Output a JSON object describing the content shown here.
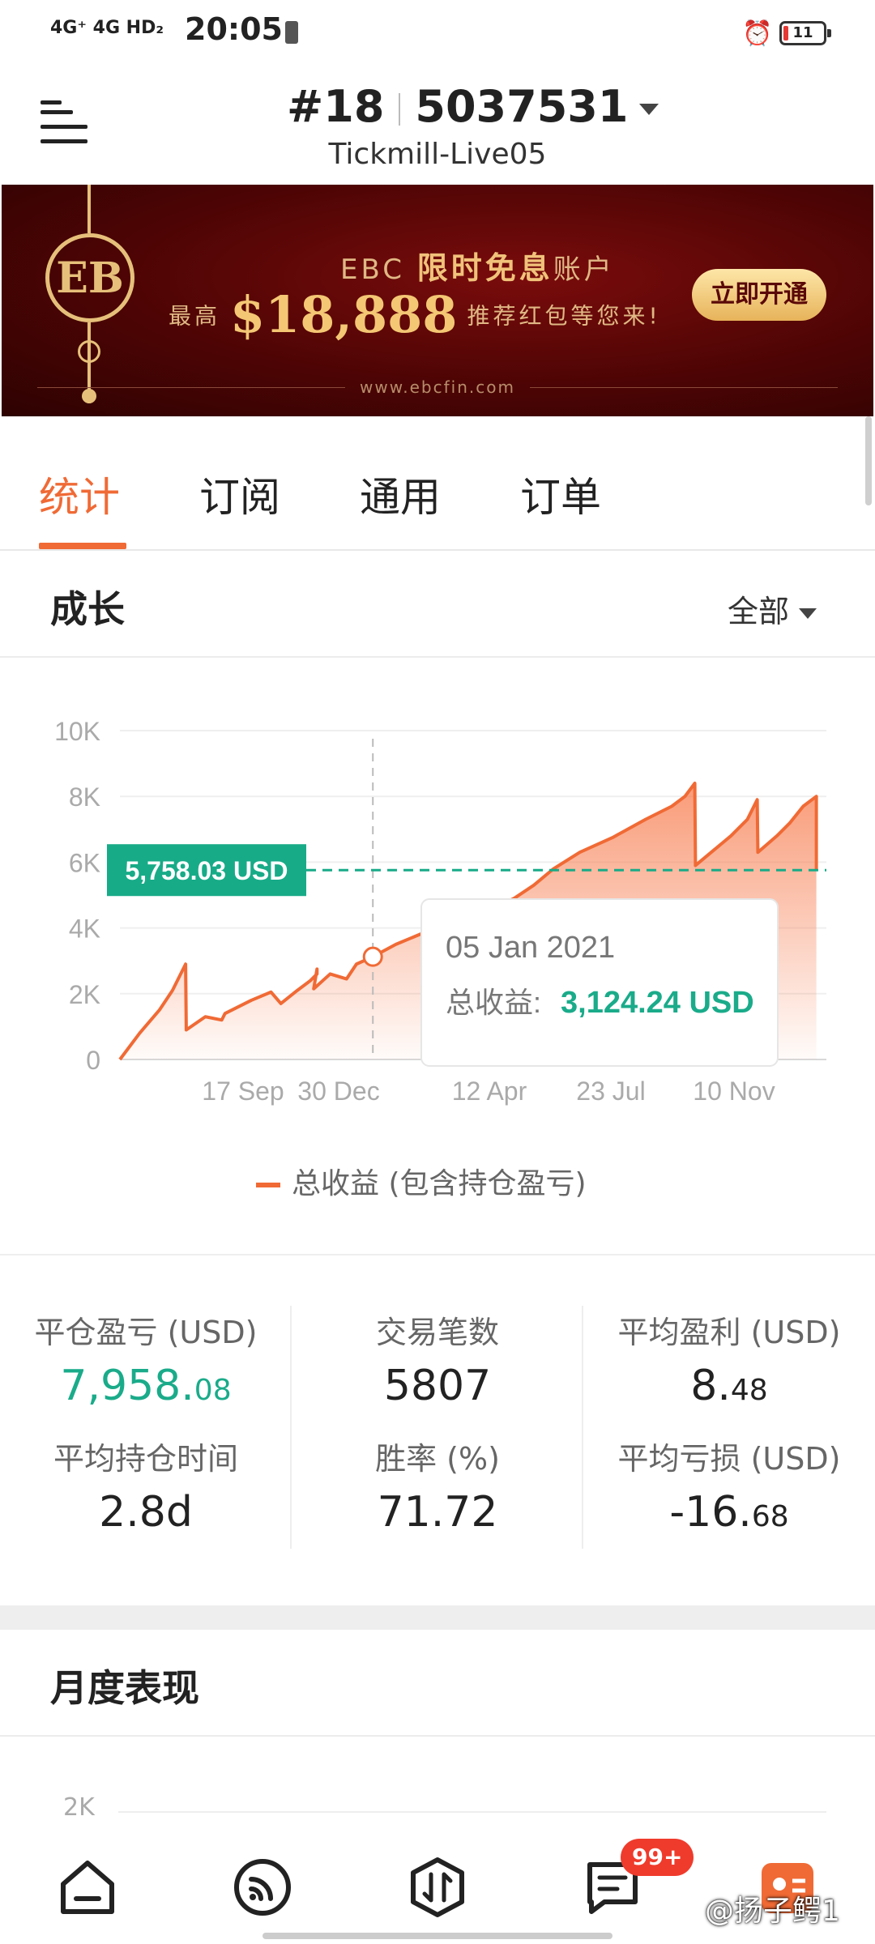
{
  "status_bar": {
    "network": "4G⁺ 4G HD₂",
    "time": "20:05",
    "battery": "11"
  },
  "header": {
    "account_prefix": "#18",
    "account_number": "5037531",
    "server": "Tickmill-Live05"
  },
  "banner": {
    "line1_brand": "EBC",
    "line1_highlight": "限时免息",
    "line1_suffix": "账户",
    "line2_prefix": "最高",
    "line2_amount": "$18,888",
    "line2_suffix": "推荐红包等您来!",
    "button_label": "立即开通",
    "url": "www.ebcfin.com",
    "logo_text": "EB"
  },
  "tabs": [
    {
      "label": "统计",
      "active": true
    },
    {
      "label": "订阅",
      "active": false
    },
    {
      "label": "通用",
      "active": false
    },
    {
      "label": "订单",
      "active": false
    }
  ],
  "growth": {
    "title": "成长",
    "filter": "全部"
  },
  "chart_data": {
    "type": "area",
    "ylim": [
      0,
      10000
    ],
    "y_ticks": [
      "0",
      "2K",
      "4K",
      "6K",
      "8K",
      "10K"
    ],
    "x_ticks": [
      "17 Sep",
      "30 Dec",
      "12 Apr",
      "23 Jul",
      "10 Nov"
    ],
    "series": [
      {
        "name": "总收益 (包含持仓盈亏)",
        "color": "#f06a35",
        "points": [
          [
            0,
            0
          ],
          [
            0.03,
            800
          ],
          [
            0.06,
            1500
          ],
          [
            0.08,
            2100
          ],
          [
            0.1,
            2900
          ],
          [
            0.101,
            900
          ],
          [
            0.13,
            1300
          ],
          [
            0.155,
            1200
          ],
          [
            0.16,
            1400
          ],
          [
            0.2,
            1800
          ],
          [
            0.23,
            2050
          ],
          [
            0.245,
            1700
          ],
          [
            0.27,
            2100
          ],
          [
            0.29,
            2400
          ],
          [
            0.3,
            2600
          ],
          [
            0.3,
            2750
          ],
          [
            0.295,
            2150
          ],
          [
            0.32,
            2600
          ],
          [
            0.345,
            2450
          ],
          [
            0.36,
            2900
          ],
          [
            0.385,
            3124.24
          ],
          [
            0.42,
            3500
          ],
          [
            0.45,
            3750
          ],
          [
            0.48,
            4000
          ],
          [
            0.52,
            4250
          ],
          [
            0.56,
            4500
          ],
          [
            0.6,
            4900
          ],
          [
            0.63,
            5300
          ],
          [
            0.66,
            5800
          ],
          [
            0.7,
            6300
          ],
          [
            0.75,
            6750
          ],
          [
            0.8,
            7300
          ],
          [
            0.84,
            7700
          ],
          [
            0.86,
            8000
          ],
          [
            0.875,
            8400
          ],
          [
            0.876,
            5900
          ],
          [
            0.9,
            6300
          ],
          [
            0.93,
            6800
          ],
          [
            0.955,
            7300
          ],
          [
            0.97,
            7900
          ],
          [
            0.971,
            6300
          ],
          [
            1.0,
            6800
          ],
          [
            1.02,
            7200
          ],
          [
            1.04,
            7700
          ],
          [
            1.06,
            8000
          ],
          [
            1.06,
            5758
          ]
        ]
      }
    ],
    "reference_line": {
      "value": 5758.03,
      "label": "5,758.03 USD",
      "color": "#18ab88"
    },
    "tooltip": {
      "date": "05 Jan 2021",
      "label": "总收益:",
      "value": "3,124.24 USD",
      "point_value": 3124.24
    }
  },
  "legend_label": "总收益 (包含持仓盈亏)",
  "stats": [
    {
      "label": "平仓盈亏 (USD)",
      "int": "7,958.",
      "dec": "08",
      "green": true
    },
    {
      "label": "交易笔数",
      "int": "5807",
      "dec": "",
      "green": false
    },
    {
      "label": "平均盈利 (USD)",
      "int": "8.",
      "dec": "48",
      "green": false
    },
    {
      "label": "平均持仓时间",
      "int": "2.8d",
      "dec": "",
      "green": false
    },
    {
      "label": "胜率 (%)",
      "int": "71.72",
      "dec": "",
      "green": false
    },
    {
      "label": "平均亏损 (USD)",
      "int": "-16.",
      "dec": "68",
      "green": false
    }
  ],
  "monthly": {
    "title": "月度表现",
    "axis_top": "2K"
  },
  "bottom_nav": {
    "badge": "99+",
    "watermark": "@扬子鳄1",
    "items": [
      "home-icon",
      "feed-icon",
      "trade-icon",
      "messages-icon",
      "profile-icon"
    ]
  },
  "colors": {
    "accent": "#f06a35",
    "positive": "#1aab8a",
    "banner_bg": "#5a0606"
  }
}
